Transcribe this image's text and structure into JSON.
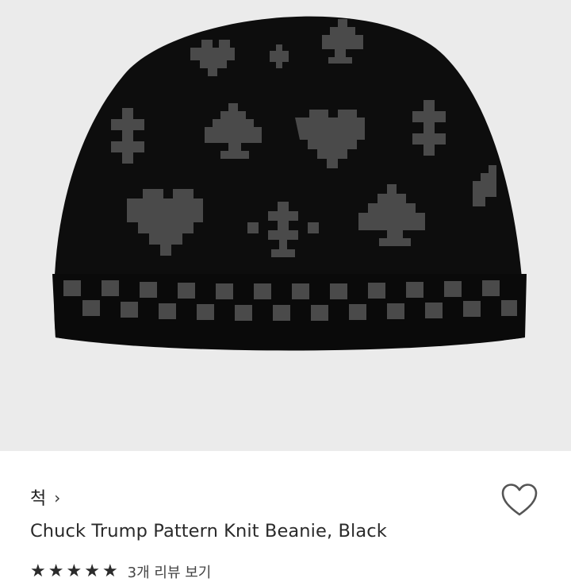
{
  "product": {
    "brand": "척",
    "brand_chevron": "›",
    "title": "Chuck Trump Pattern Knit Beanie, Black",
    "rating": 5,
    "review_link": "3개 리뷰 보기"
  },
  "icons": {
    "wishlist": "heart-outline-icon",
    "chevron": "chevron-right-icon",
    "star": "star-icon"
  },
  "colors": {
    "image_background": "#ebebeb",
    "beanie": "#0d0d0d",
    "pattern": "#4a4a4a",
    "text": "#2a2a2a"
  }
}
